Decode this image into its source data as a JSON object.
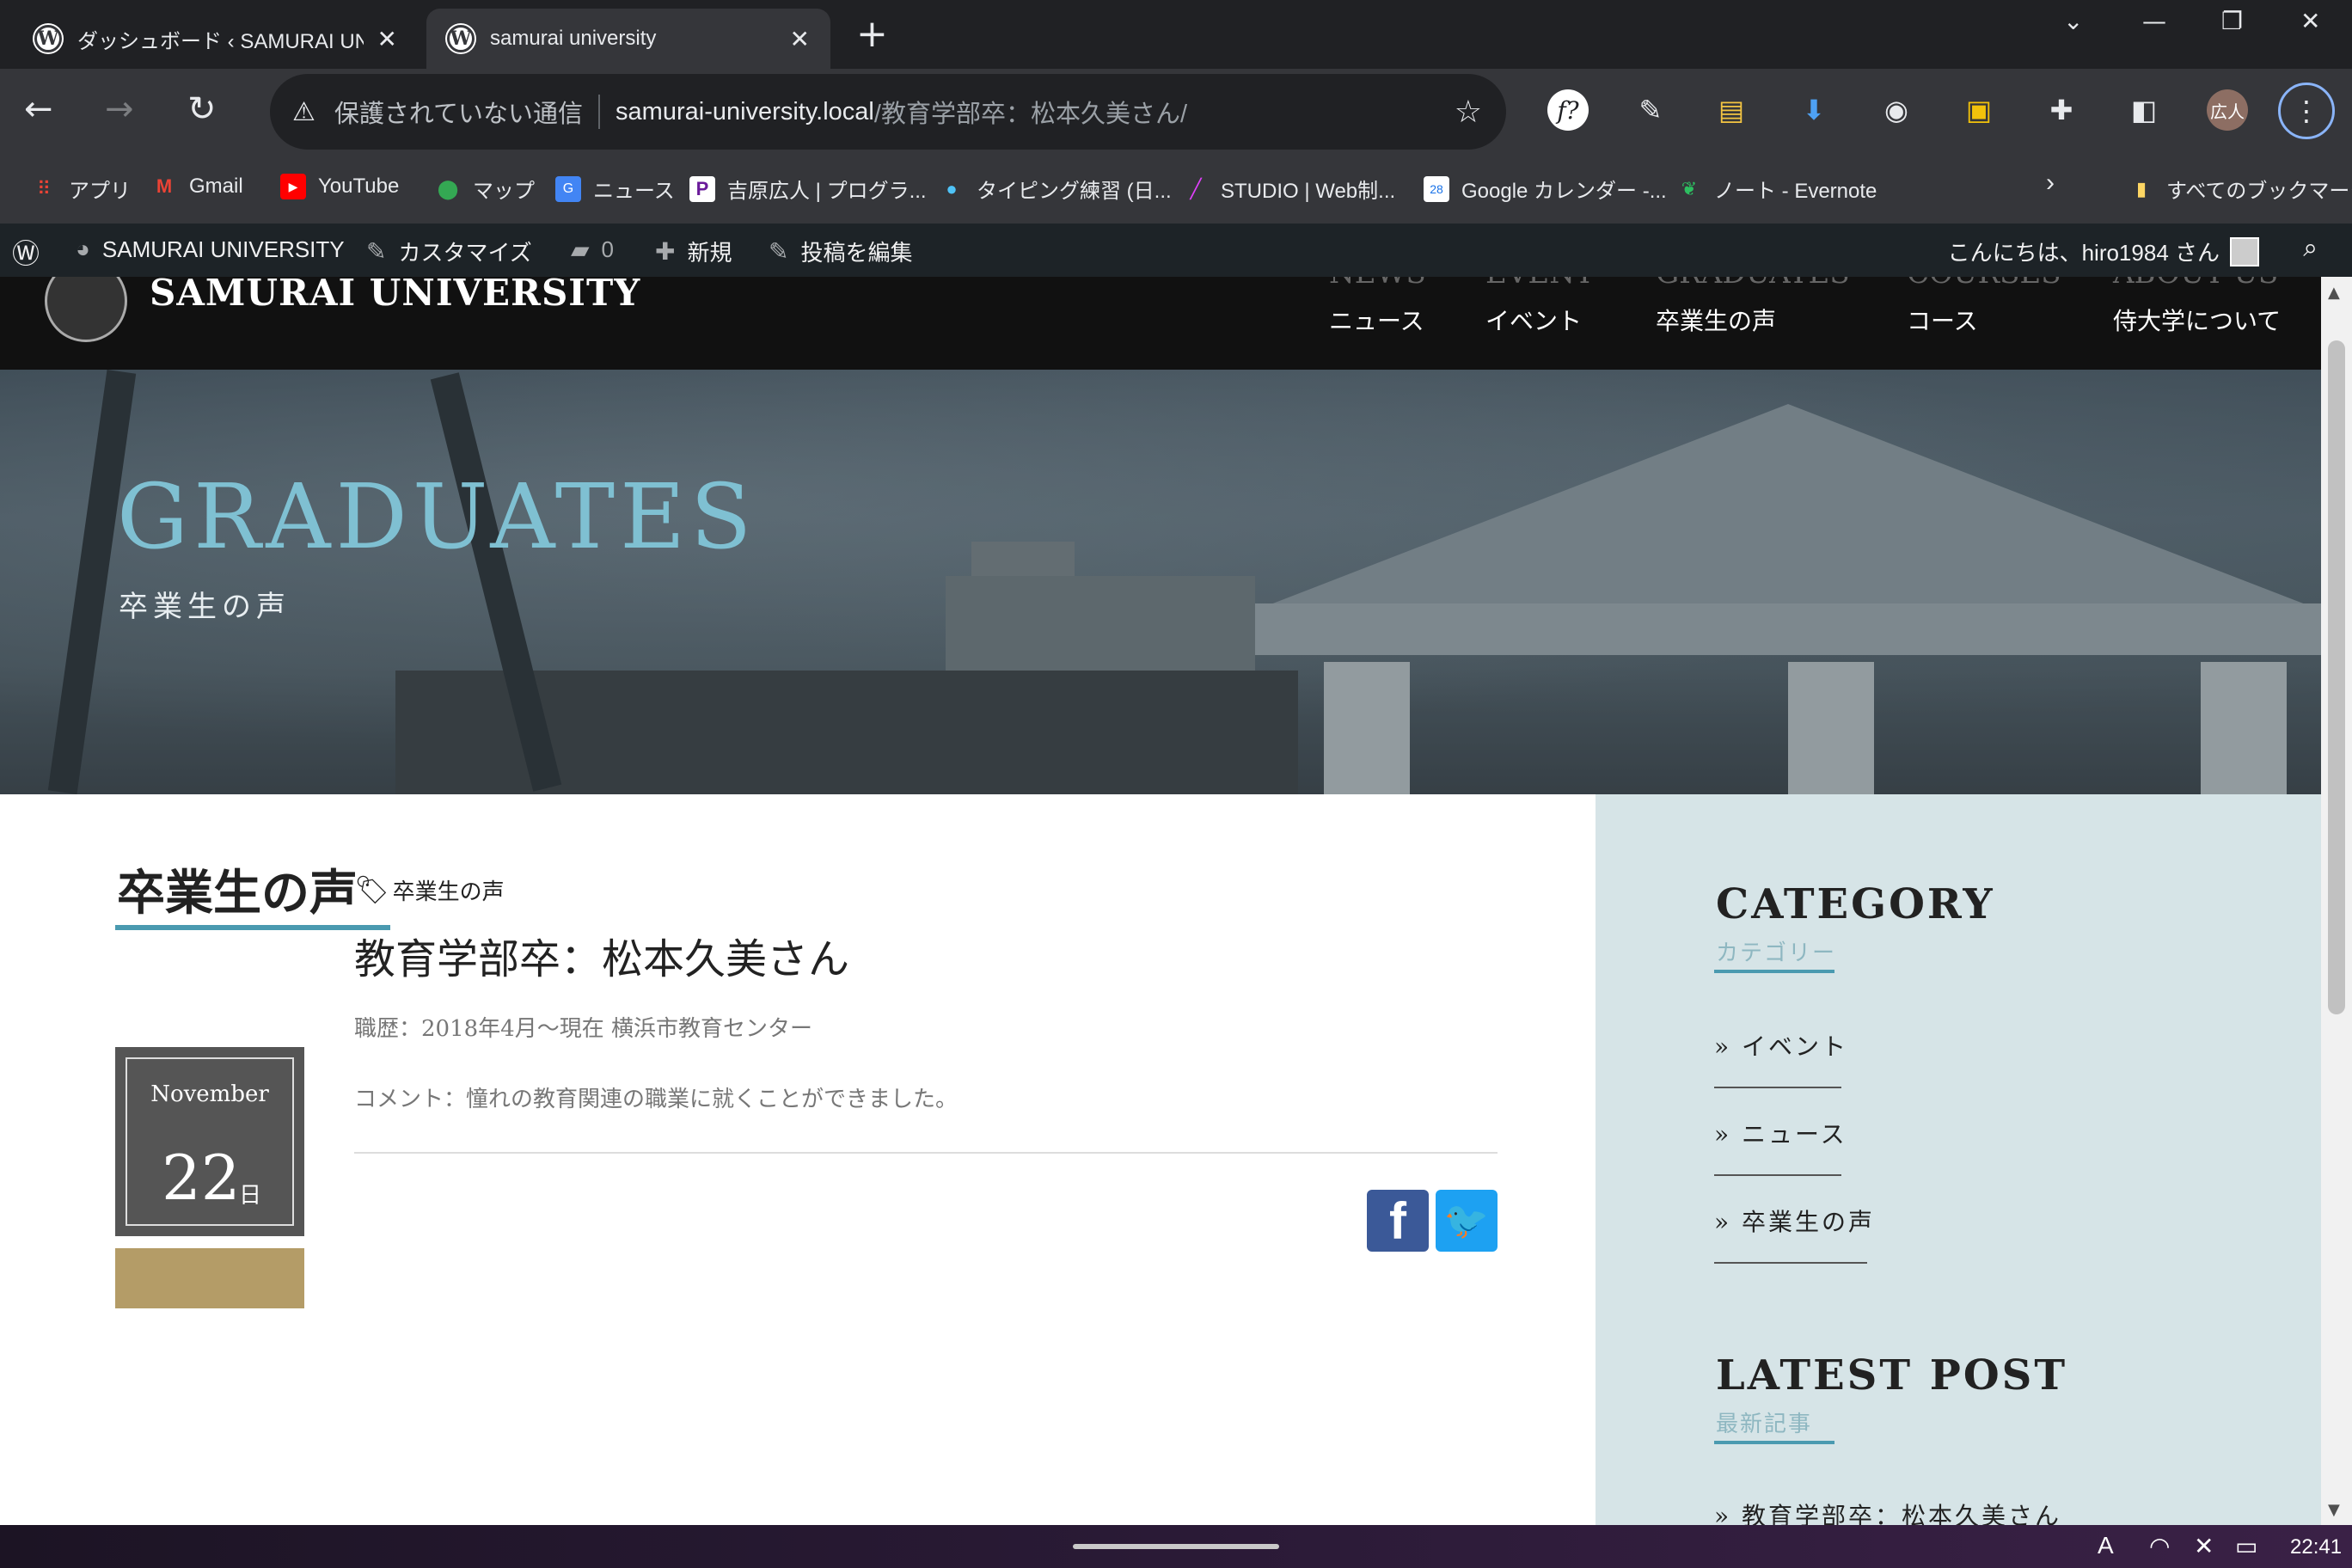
{
  "tabs": [
    {
      "title": "ダッシュボード ‹ SAMURAI UNIVERSITY",
      "favicon": "W",
      "active": false
    },
    {
      "title": "samurai university",
      "favicon": "W",
      "active": true
    }
  ],
  "newtab_glyph": "+",
  "close_glyph": "✕",
  "window_controls": {
    "chevron": "⌄",
    "minimize": "—",
    "restore": "❐",
    "close": "✕"
  },
  "nav": {
    "back": "←",
    "forward": "→",
    "reload": "↻"
  },
  "omnibox": {
    "warning_icon": "⚠",
    "insecure_label": "保護されていない通信",
    "host": "samurai-university.local",
    "path": "/教育学部卒：松本久美さん/"
  },
  "extensions": {
    "fq": "f?",
    "avatar": "広人",
    "menu": "⋮"
  },
  "bookmarks": [
    {
      "label": "アプリ",
      "icon": "apps-icon"
    },
    {
      "label": "Gmail",
      "icon": "gmail-icon"
    },
    {
      "label": "YouTube",
      "icon": "youtube-icon"
    },
    {
      "label": "マップ",
      "icon": "maps-icon"
    },
    {
      "label": "ニュース",
      "icon": "news-icon"
    },
    {
      "label": "吉原広人 | プログラ...",
      "icon": "p-icon"
    },
    {
      "label": "タイピング練習 (日...",
      "icon": "typing-icon"
    },
    {
      "label": "STUDIO | Web制...",
      "icon": "studio-icon"
    },
    {
      "label": "Google カレンダー -...",
      "icon": "calendar-icon"
    },
    {
      "label": "ノート - Evernote",
      "icon": "evernote-icon"
    }
  ],
  "bookmarks_all": "すべてのブックマーク",
  "calendar_day": "28",
  "wpbar": {
    "site": "SAMURAI UNIVERSITY",
    "customize": "カスタマイズ",
    "comments": "0",
    "new": "新規",
    "edit": "投稿を編集",
    "greeting": "こんにちは、hiro1984 さん"
  },
  "site": {
    "brand": "SAMURAI UNIVERSITY",
    "nav": [
      {
        "en": "NEWS",
        "ja": "ニュース"
      },
      {
        "en": "EVENT",
        "ja": "イベント"
      },
      {
        "en": "GRADUATES",
        "ja": "卒業生の声"
      },
      {
        "en": "COURSES",
        "ja": "コース"
      },
      {
        "en": "ABOUT US",
        "ja": "侍大学について"
      }
    ]
  },
  "hero": {
    "title": "GRADUATES",
    "subtitle": "卒業生の声"
  },
  "main": {
    "heading": "卒業生の声",
    "post": {
      "month": "November",
      "day": "22",
      "day_unit": "日",
      "category": "卒業生の声",
      "title": "教育学部卒：松本久美さん",
      "career": "職歴：2018年4月～現在 横浜市教育センター",
      "comment": "コメント：憧れの教育関連の職業に就くことができました。"
    },
    "share": {
      "facebook": "f",
      "twitter": "🐦"
    }
  },
  "sidebar": {
    "category_title": "CATEGORY",
    "category_sub": "カテゴリー",
    "categories": [
      "» イベント",
      "» ニュース",
      "» 卒業生の声"
    ],
    "latest_title": "LATEST POST",
    "latest_sub": "最新記事",
    "latest": [
      "» 教育学部卒：松本久美さん"
    ]
  },
  "taskbar": {
    "clock": "22:41"
  },
  "colors": {
    "accent": "#4a9ab0",
    "gold": "#b49c67",
    "hero_title": "#7fc0d2",
    "sidebar_bg": "#d6e4e7"
  }
}
